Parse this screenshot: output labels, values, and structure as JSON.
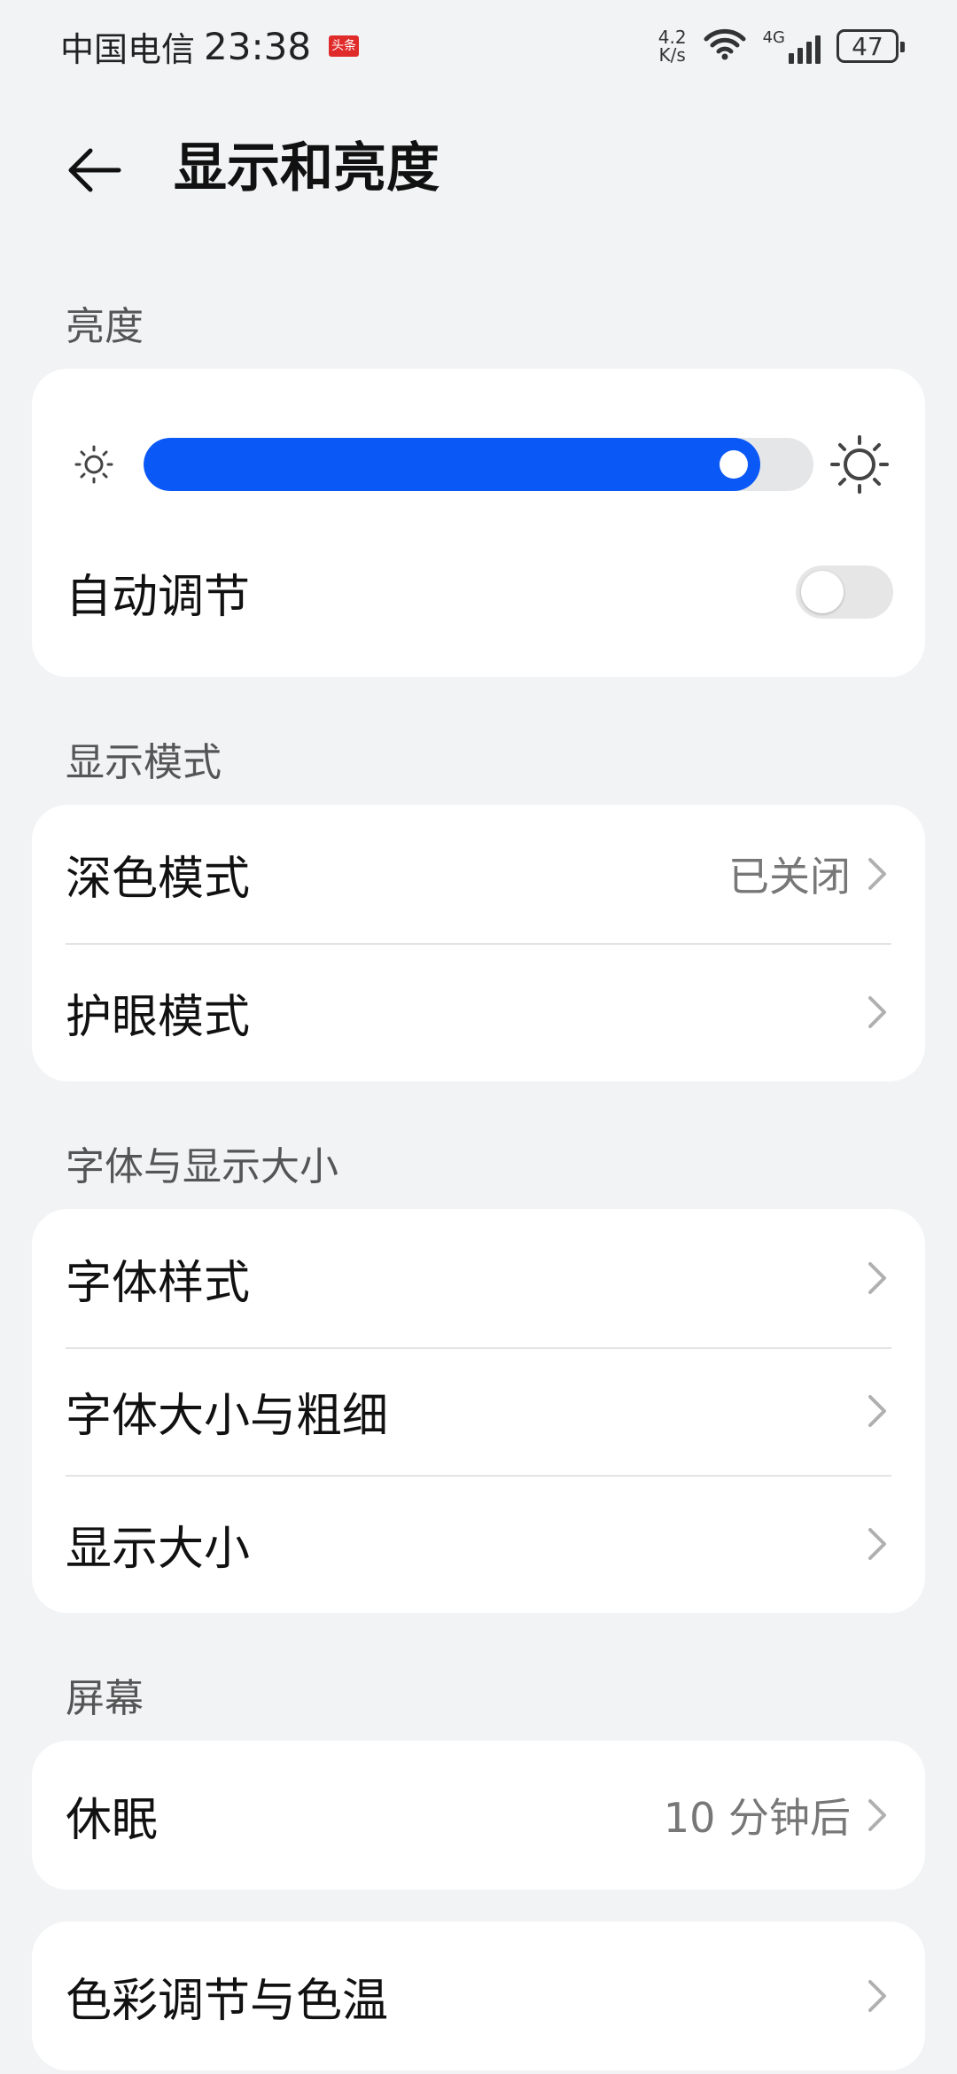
{
  "status_bar": {
    "carrier": "中国电信",
    "time": "23:38",
    "app_badge": "头条",
    "net_speed_value": "4.2",
    "net_speed_unit": "K/s",
    "network_type": "4G",
    "battery": "47"
  },
  "header": {
    "title": "显示和亮度"
  },
  "brightness": {
    "section_label": "亮度",
    "level_fraction": 0.92,
    "auto_label": "自动调节",
    "auto_enabled": false
  },
  "display_mode": {
    "section_label": "显示模式",
    "dark_mode_label": "深色模式",
    "dark_mode_value": "已关闭",
    "eye_comfort_label": "护眼模式"
  },
  "font_display": {
    "section_label": "字体与显示大小",
    "font_style_label": "字体样式",
    "font_size_label": "字体大小与粗细",
    "display_size_label": "显示大小"
  },
  "screen": {
    "section_label": "屏幕",
    "sleep_label": "休眠",
    "sleep_value": "10 分钟后",
    "color_label": "色彩调节与色温"
  },
  "colors": {
    "accent": "#0a59f7",
    "background": "#f1f3f5",
    "card": "#ffffff"
  }
}
